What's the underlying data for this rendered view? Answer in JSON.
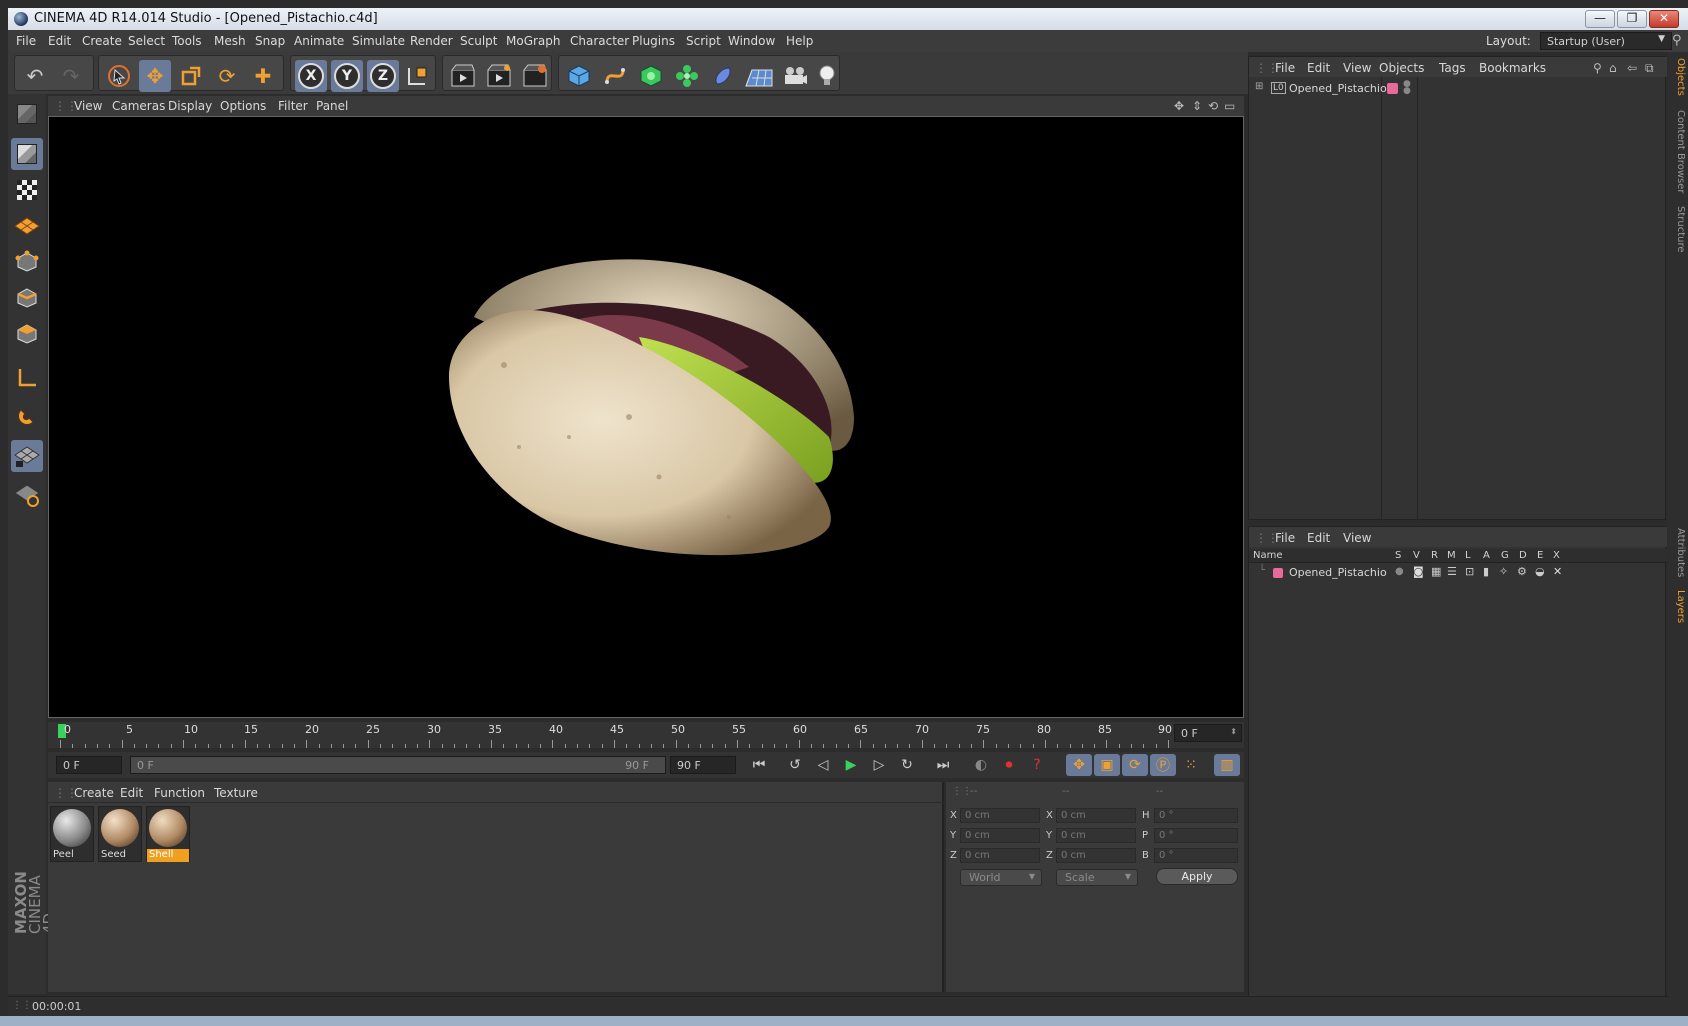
{
  "window": {
    "title": "CINEMA 4D R14.014 Studio - [Opened_Pistachio.c4d]",
    "controls": [
      "—",
      "❐",
      "✕"
    ]
  },
  "menubar": {
    "items": [
      "File",
      "Edit",
      "Create",
      "Select",
      "Tools",
      "Mesh",
      "Snap",
      "Animate",
      "Simulate",
      "Render",
      "Sculpt",
      "MoGraph",
      "Character",
      "Plugins",
      "Script",
      "Window",
      "Help"
    ],
    "layout_label": "Layout:",
    "layout_value": "Startup (User)"
  },
  "toolbar": {
    "axis_x": "X",
    "axis_y": "Y",
    "axis_z": "Z"
  },
  "viewport": {
    "menu": [
      "View",
      "Cameras",
      "Display",
      "Options",
      "Filter",
      "Panel"
    ]
  },
  "timeline": {
    "ticks": [
      "0",
      "5",
      "10",
      "15",
      "20",
      "25",
      "30",
      "35",
      "40",
      "45",
      "50",
      "55",
      "60",
      "65",
      "70",
      "75",
      "80",
      "85",
      "90"
    ],
    "current_frame": "0 F",
    "start_field": "0 F",
    "range_start": "0 F",
    "range_end": "90 F",
    "end_field": "90 F"
  },
  "materials": {
    "menu": [
      "Create",
      "Edit",
      "Function",
      "Texture"
    ],
    "items": [
      {
        "label": "Peel",
        "selected": false
      },
      {
        "label": "Seed",
        "selected": false
      },
      {
        "label": "Shell",
        "selected": true
      }
    ]
  },
  "coordinates": {
    "headers": [
      "--",
      "--",
      "--"
    ],
    "rows": [
      {
        "a": "X",
        "av": "0 cm",
        "b": "X",
        "bv": "0 cm",
        "c": "H",
        "cv": "0 °"
      },
      {
        "a": "Y",
        "av": "0 cm",
        "b": "Y",
        "bv": "0 cm",
        "c": "P",
        "cv": "0 °"
      },
      {
        "a": "Z",
        "av": "0 cm",
        "b": "Z",
        "bv": "0 cm",
        "c": "B",
        "cv": "0 °"
      }
    ],
    "space": "World",
    "mode": "Scale",
    "apply": "Apply"
  },
  "objects_panel": {
    "menu": [
      "File",
      "Edit",
      "View",
      "Objects",
      "Tags",
      "Bookmarks"
    ],
    "object_name": "Opened_Pistachio",
    "object_icon_label": "L0"
  },
  "layers_panel": {
    "menu": [
      "File",
      "Edit",
      "View"
    ],
    "columns": [
      "Name",
      "S",
      "V",
      "R",
      "M",
      "L",
      "A",
      "G",
      "D",
      "E",
      "X"
    ],
    "layer_name": "Opened_Pistachio",
    "layer_color": "#e86a9a"
  },
  "side_tabs": [
    "Objects",
    "Content Browser",
    "Structure",
    "Attributes",
    "Layers"
  ],
  "branding": {
    "maxon": "MAXON",
    "product": "CINEMA 4D"
  },
  "status": {
    "time": "00:00:01"
  },
  "colors": {
    "accent_orange": "#f0a030",
    "selection_blue": "#6a7b9a",
    "material_selected": "#f0a020"
  }
}
